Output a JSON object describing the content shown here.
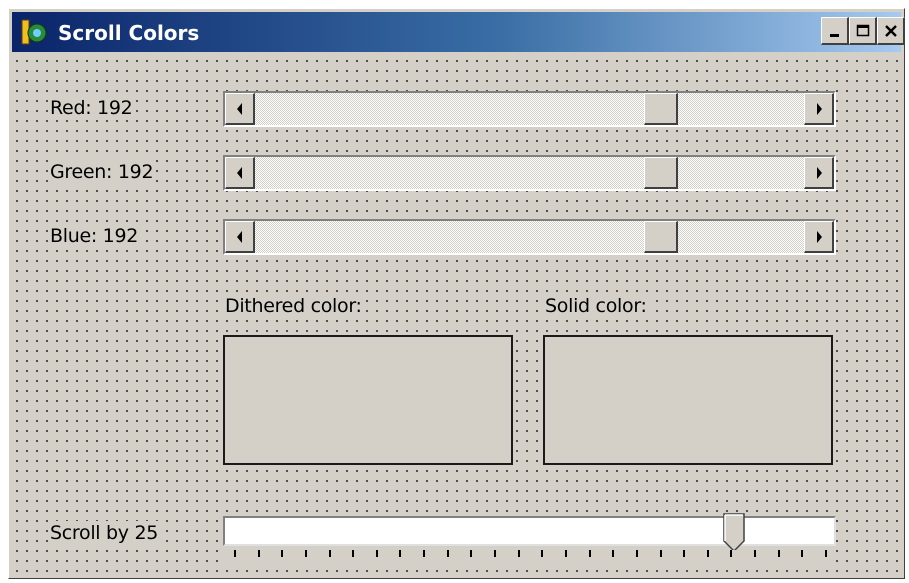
{
  "window": {
    "title": "Scroll Colors",
    "icon": "app-icon",
    "controls": [
      "minimize-icon",
      "maximize-icon",
      "close-icon"
    ]
  },
  "sliders": [
    {
      "label": "Red: 192",
      "value": 192,
      "max": 255
    },
    {
      "label": "Green: 192",
      "value": 192,
      "max": 255
    },
    {
      "label": "Blue: 192",
      "value": 192,
      "max": 255
    }
  ],
  "dithered": {
    "label": "Dithered color:",
    "color": "#c0c0c0"
  },
  "solid": {
    "label": "Solid color:",
    "color": "#c0c0c0"
  },
  "scroll_by": {
    "label": "Scroll by 25",
    "position": 0.82,
    "tick_count": 26
  }
}
